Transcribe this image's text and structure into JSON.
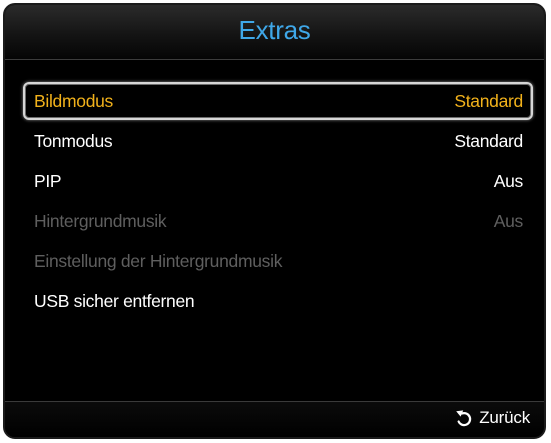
{
  "title": "Extras",
  "menu": {
    "items": [
      {
        "label": "Bildmodus",
        "value": "Standard",
        "state": "selected"
      },
      {
        "label": "Tonmodus",
        "value": "Standard",
        "state": "enabled"
      },
      {
        "label": "PIP",
        "value": "Aus",
        "state": "enabled"
      },
      {
        "label": "Hintergrundmusik",
        "value": "Aus",
        "state": "disabled"
      },
      {
        "label": "Einstellung der Hintergrundmusik",
        "value": "",
        "state": "disabled"
      },
      {
        "label": "USB sicher entfernen",
        "value": "",
        "state": "enabled"
      }
    ]
  },
  "footer": {
    "back_label": "Zurück",
    "back_icon": "return-arrow-icon"
  },
  "colors": {
    "title": "#3fa7e8",
    "selected_text": "#f2b21b",
    "enabled_text": "#ffffff",
    "disabled_text": "#5f5f5f",
    "background": "#000000"
  }
}
